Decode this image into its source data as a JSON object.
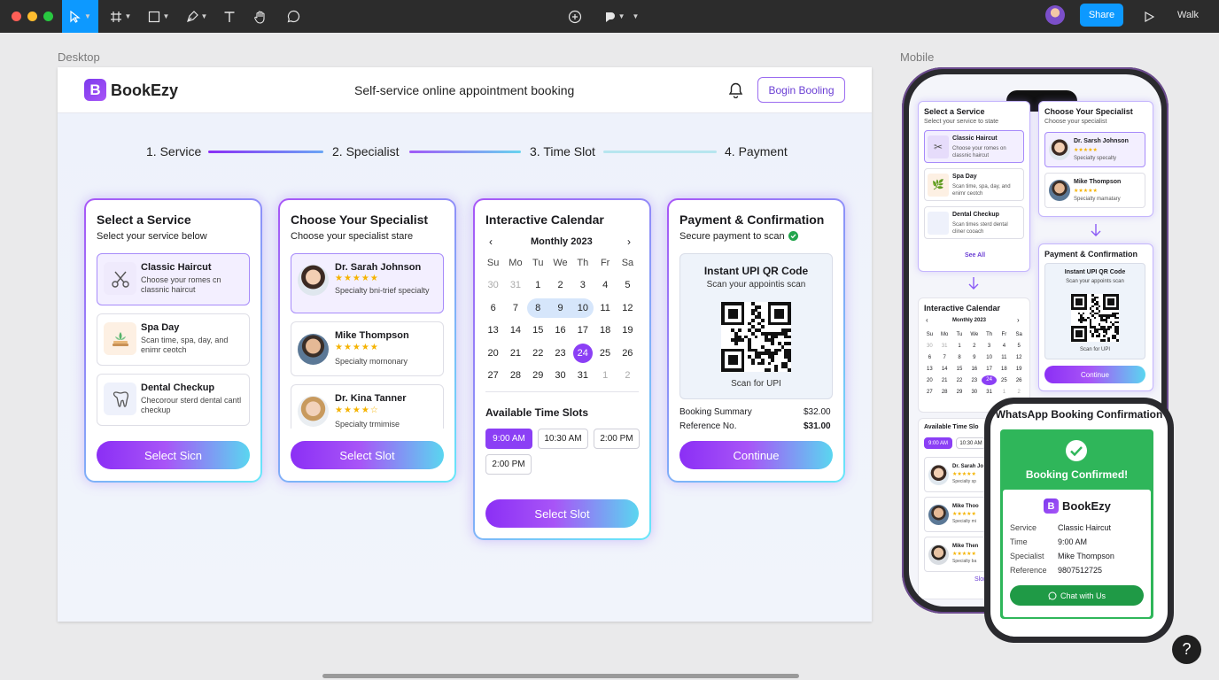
{
  "toolbar": {
    "share_label": "Share",
    "walk_label": "Walk"
  },
  "frames": {
    "desktop_label": "Desktop",
    "mobile_label": "Mobile"
  },
  "header": {
    "logo_letter": "B",
    "brand": "BookEzy",
    "tagline": "Self-service online appointment booking",
    "begin_button": "Bogin Booling"
  },
  "steps": [
    "1. Service",
    "2. Specialist",
    "3. Time Slot",
    "4. Payment"
  ],
  "service_card": {
    "title": "Select a Service",
    "subtitle": "Select your service below",
    "options": [
      {
        "title": "Classic Haircut",
        "desc": "Choose your romes cn classnic haircut",
        "icon": "scissors-icon"
      },
      {
        "title": "Spa Day",
        "desc": "Scan time, spa, day, and enimr ceotch",
        "icon": "spa-icon"
      },
      {
        "title": "Dental Checkup",
        "desc": "Checorour sterd dental cantl checkup",
        "icon": "tooth-icon"
      }
    ],
    "button": "Select Sicn"
  },
  "specialist_card": {
    "title": "Choose Your Specialist",
    "subtitle": "Choose your specialist stare",
    "specialists": [
      {
        "name": "Dr. Sarah Johnson",
        "stars": "★★★★★",
        "desc": "Specialty bni-trief specialty"
      },
      {
        "name": "Mike Thompson",
        "stars": "★★★★★",
        "desc": "Specialty mornonary"
      },
      {
        "name": "Dr. Kina Tanner",
        "stars": "★★★★☆",
        "desc": "Specialty trmimise"
      }
    ],
    "button": "Select Slot"
  },
  "calendar_card": {
    "title": "Interactive Calendar",
    "month": "Monthly 2023",
    "weekdays": [
      "Su",
      "Mo",
      "Tu",
      "We",
      "Th",
      "Fr",
      "Sa"
    ],
    "weeks": [
      [
        "30",
        "31",
        "1",
        "2",
        "3",
        "4",
        "5"
      ],
      [
        "6",
        "7",
        "8",
        "9",
        "10",
        "11",
        "12"
      ],
      [
        "13",
        "14",
        "15",
        "16",
        "17",
        "18",
        "19"
      ],
      [
        "20",
        "21",
        "22",
        "23",
        "24",
        "25",
        "26"
      ],
      [
        "27",
        "28",
        "29",
        "30",
        "31",
        "1",
        "2"
      ]
    ],
    "selected_day": "24",
    "slots_title": "Available Time Slots",
    "slots": [
      "9:00 AM",
      "10:30 AM",
      "2:00 PM",
      "2:00 PM"
    ],
    "button": "Select Slot"
  },
  "payment_card": {
    "title": "Payment & Confirmation",
    "subtitle": "Secure payment to scan",
    "qr_title": "Instant UPI QR Code",
    "qr_sub": "Scan your appointis scan",
    "qr_caption": "Scan for UPI",
    "summary_label": "Booking Summary",
    "summary_value": "$32.00",
    "ref_label": "Reference No.",
    "ref_value": "$31.00",
    "button": "Continue"
  },
  "mobile": {
    "service_title": "Select a Service",
    "service_sub": "Select your service to state",
    "options": [
      {
        "title": "Classic Haircut",
        "desc": "Choose your romes on classnic haircut"
      },
      {
        "title": "Spa Day",
        "desc": "Scan time, spa, day, and enimr ceotch"
      },
      {
        "title": "Dental Checkup",
        "desc": "Scan times sterd dental cliner cooach"
      }
    ],
    "see_all": "See All",
    "spec_title": "Choose Your Specialist",
    "spec_sub": "Choose your specialist",
    "specialists": [
      {
        "name": "Dr. Sarsh Johnson",
        "desc": "Specialty specalty"
      },
      {
        "name": "Mike Thompson",
        "desc": "Specialty mamatary"
      }
    ],
    "pay_title": "Payment & Confirmation",
    "qr_title": "Instant UPI QR Code",
    "qr_sub": "Scan your appoints scan",
    "qr_caption": "Scan for UPI",
    "continue": "Continue",
    "cal_title": "Interactive Calendar",
    "cal_month": "Monthly 2023",
    "slots_title": "Available Time Slo",
    "slots": [
      "9:00 AM",
      "10:30 AM"
    ],
    "list": [
      {
        "name": "Dr. Sarah Jo",
        "desc": "Specialty sp"
      },
      {
        "name": "Mike Thoo",
        "desc": "Specialty mi"
      },
      {
        "name": "Mike Then",
        "desc": "Specialty ba"
      }
    ],
    "more": "Slone"
  },
  "watch": {
    "title": "WhatsApp Booking Confirmation",
    "confirmed": "Booking Confirmed!",
    "brand": "BookEzy",
    "rows": [
      {
        "label": "Service",
        "value": "Classic Haircut"
      },
      {
        "label": "Time",
        "value": "9:00 AM"
      },
      {
        "label": "Specialist",
        "value": "Mike Thompson"
      },
      {
        "label": "Reference",
        "value": "9807512725"
      }
    ],
    "chat_button": "Chat with Us"
  },
  "help_label": "?"
}
